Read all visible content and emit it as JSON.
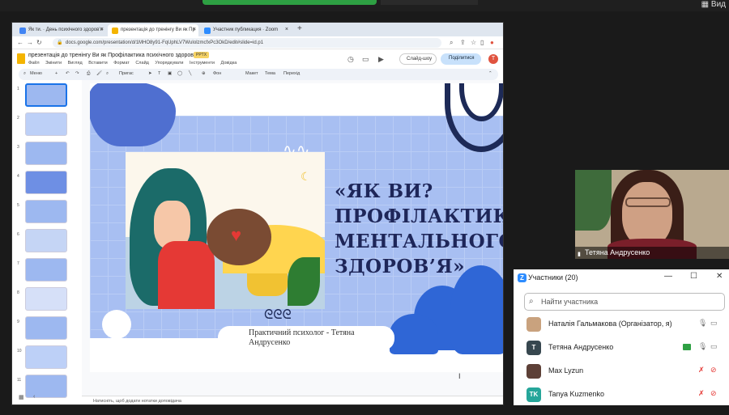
{
  "zoom": {
    "view_label": "Вид",
    "view_icon": "grid-view-icon"
  },
  "browser": {
    "tabs": [
      {
        "label": "Як ти. · День психічного здоров'я"
      },
      {
        "label": "презентація до тренінгу Ви як Пр"
      },
      {
        "label": "Участник публикация · Zoom"
      }
    ],
    "new_tab": "+",
    "url": "docs.google.com/presentation/d/1MHO8y91-FqUphLV7WuIolzmcfxPc3OkD/edit#slide=id.p1"
  },
  "docs": {
    "title": "презентація до тренінгу Ви як Профілактика психічного здоров'я",
    "pptx_badge": "PPTX",
    "menu": [
      "Файл",
      "Змінити",
      "Вигляд",
      "Вставити",
      "Формат",
      "Слайд",
      "Упорядкувати",
      "Інструменти",
      "Довідка"
    ],
    "slideshow_label": "Слайд-шоу",
    "share_label": "Поділитися",
    "avatar_letter": "T",
    "toolbar": {
      "menus": "Меню",
      "background": "Фон",
      "layout": "Макет",
      "theme": "Тема",
      "transition": "Перехід",
      "prompt": "Пригас"
    },
    "slide_numbers": [
      "1",
      "2",
      "3",
      "4",
      "5",
      "6",
      "7",
      "8",
      "9",
      "10",
      "11"
    ],
    "notes_placeholder": "Натисніть, щоб додати нотатки доповідача"
  },
  "slide": {
    "title": "«ЯК ВИ? ПРОФІЛАКТИКА МЕНТАЛЬНОГО ЗДОРОВ’Я»",
    "subtitle": "Практичний психолог - Тетяна Андрусенко"
  },
  "camera": {
    "name": "Тетяна Андрусенко"
  },
  "participants": {
    "header": "Участники (20)",
    "search_placeholder": "Найти участника",
    "list": [
      {
        "name": "Наталія Гальмакова (Організатор, я)",
        "avatar": "",
        "color": "#c9a27e"
      },
      {
        "name": "Тетяна Андрусенко",
        "avatar": "T",
        "color": "#37474f"
      },
      {
        "name": "Max Lyzun",
        "avatar": "",
        "color": "#5d4037"
      },
      {
        "name": "Tanya Kuzmenko",
        "avatar": "TK",
        "color": "#26a69a"
      }
    ]
  }
}
